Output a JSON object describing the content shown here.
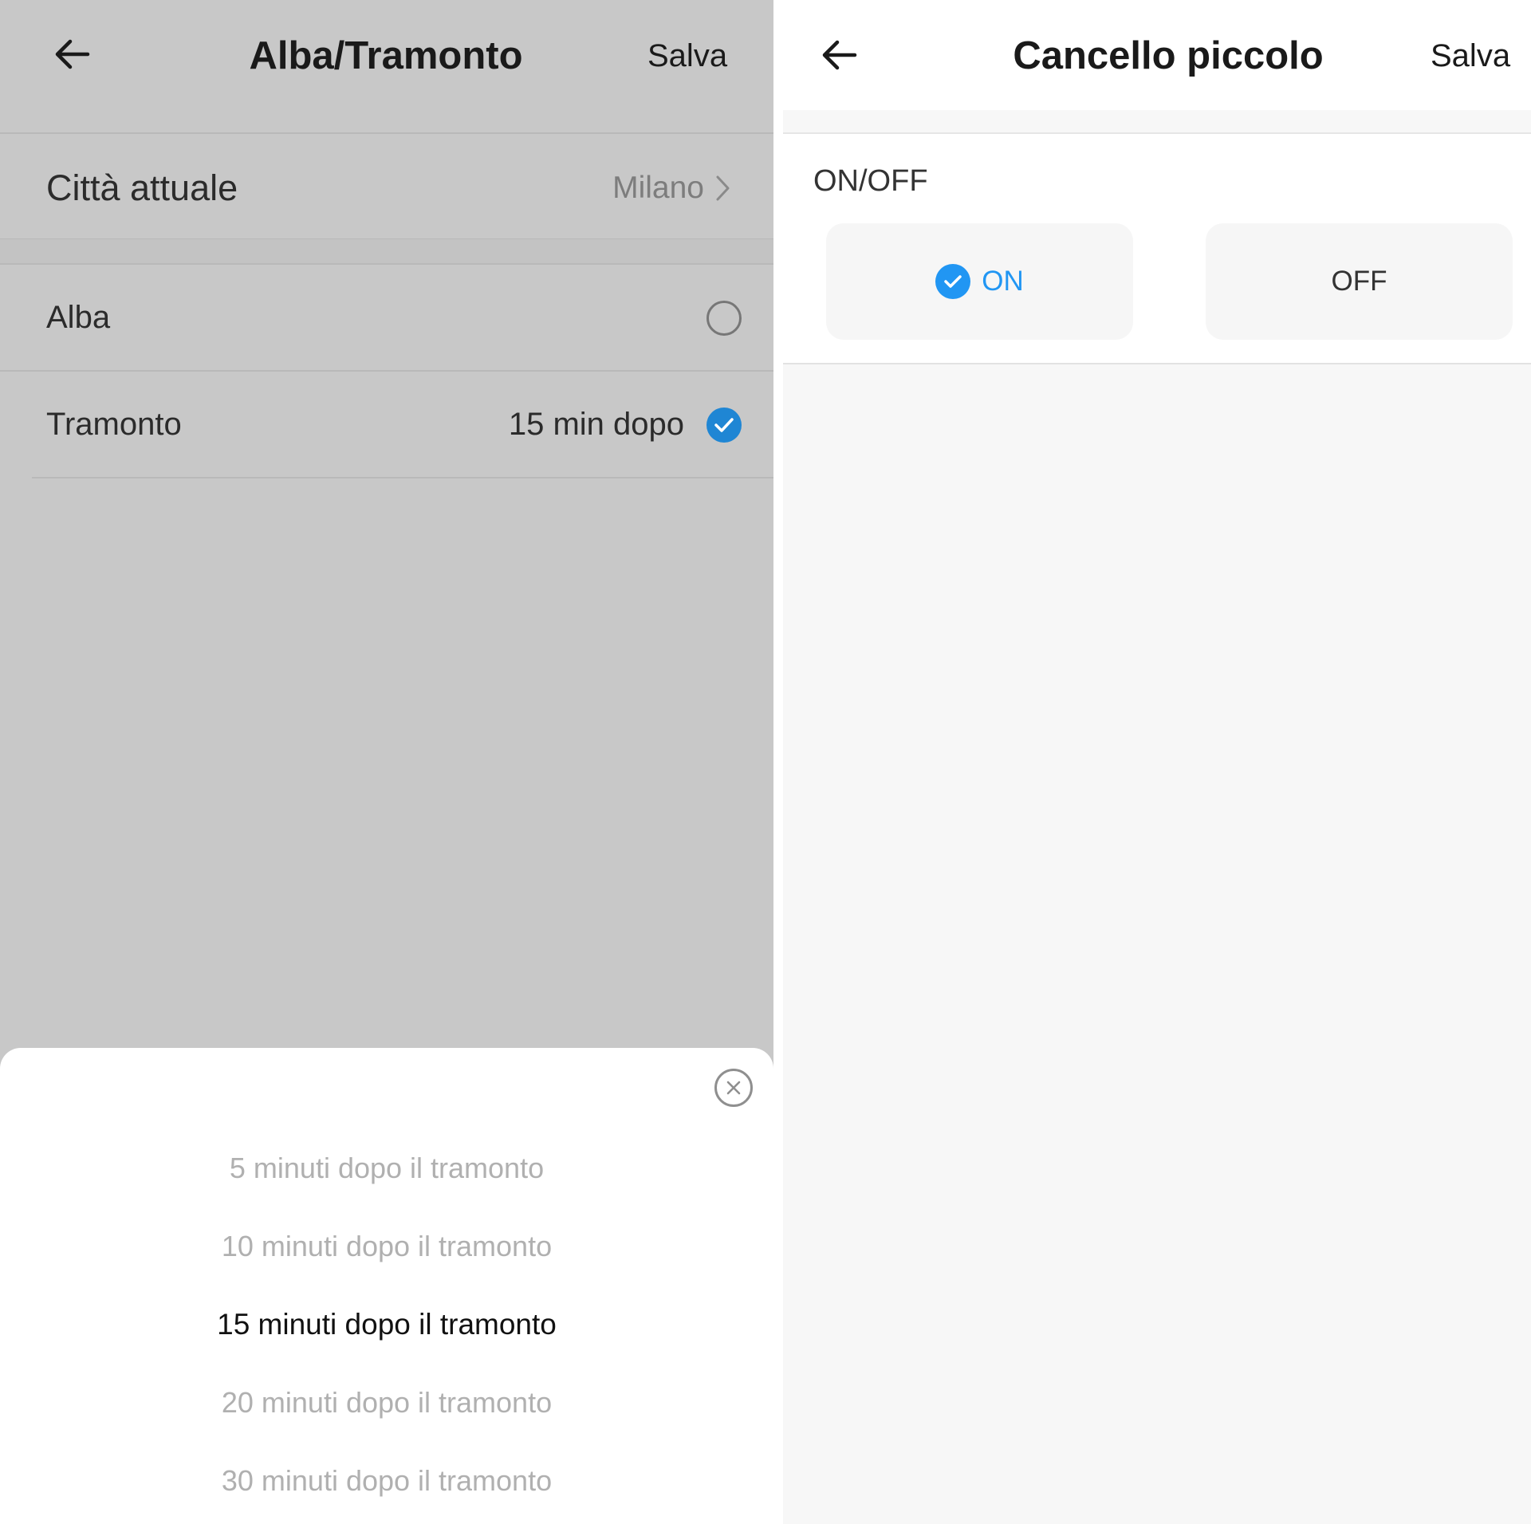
{
  "left_screen": {
    "header": {
      "title": "Alba/Tramonto",
      "save_label": "Salva"
    },
    "city_row": {
      "label": "Città attuale",
      "value": "Milano"
    },
    "options": [
      {
        "label": "Alba",
        "value": "",
        "checked": false
      },
      {
        "label": "Tramonto",
        "value": "15 min dopo",
        "checked": true
      }
    ],
    "picker": {
      "items": [
        "5 minuti dopo il tramonto",
        "10 minuti dopo il tramonto",
        "15 minuti dopo il tramonto",
        "20 minuti dopo il tramonto",
        "30 minuti dopo il tramonto"
      ],
      "selected_index": 2
    }
  },
  "right_screen": {
    "header": {
      "title": "Cancello piccolo",
      "save_label": "Salva"
    },
    "section_label": "ON/OFF",
    "toggle": {
      "on_label": "ON",
      "off_label": "OFF",
      "selected": "ON"
    }
  },
  "colors": {
    "accent_blue": "#2196f3",
    "checked_radio_blue": "#1f86d4",
    "dim_overlay": "#c8c8c8"
  }
}
